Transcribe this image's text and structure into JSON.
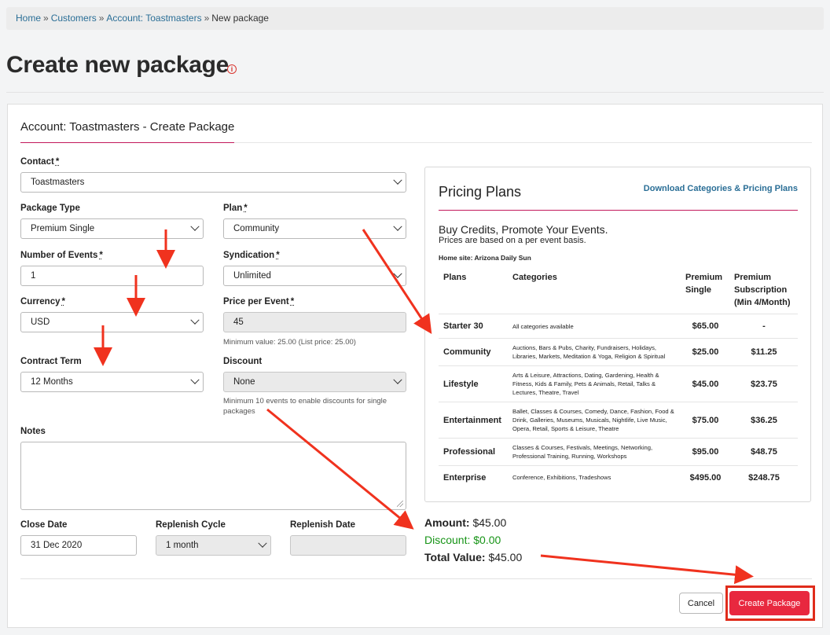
{
  "breadcrumb": {
    "items": [
      {
        "label": "Home"
      },
      {
        "label": "Customers"
      },
      {
        "label": "Account: Toastmasters"
      }
    ],
    "current": "New package",
    "separator": "»"
  },
  "page": {
    "title": "Create new package",
    "info_icon": "info-circle-icon"
  },
  "card": {
    "title": "Account: Toastmasters - Create Package"
  },
  "form": {
    "contact": {
      "label": "Contact",
      "required": "*",
      "value": "Toastmasters"
    },
    "package_type": {
      "label": "Package Type",
      "value": "Premium Single"
    },
    "plan": {
      "label": "Plan",
      "required": "*",
      "value": "Community"
    },
    "number_of_events": {
      "label": "Number of Events",
      "required": "*",
      "value": "1"
    },
    "syndication": {
      "label": "Syndication",
      "required": "*",
      "value": "Unlimited"
    },
    "currency": {
      "label": "Currency",
      "required": "*",
      "value": "USD"
    },
    "price_per_event": {
      "label": "Price per Event",
      "required": "*",
      "value": "45",
      "hint": "Minimum value: 25.00 (List price: 25.00)"
    },
    "contract_term": {
      "label": "Contract Term",
      "value": "12 Months"
    },
    "discount": {
      "label": "Discount",
      "value": "None",
      "hint_line1": "Minimum 10 events to enable discounts for single",
      "hint_line2": "packages"
    },
    "notes": {
      "label": "Notes",
      "value": ""
    },
    "close_date": {
      "label": "Close Date",
      "value": "31 Dec 2020"
    },
    "replenish_cycle": {
      "label": "Replenish Cycle",
      "value": "1 month"
    },
    "replenish_date": {
      "label": "Replenish Date",
      "value": ""
    }
  },
  "pricing": {
    "title": "Pricing Plans",
    "download_link": "Download Categories & Pricing Plans",
    "subtitle": "Buy Credits, Promote Your Events.",
    "note": "Prices are based on a per event basis.",
    "home_site": "Home site: Arizona Daily Sun",
    "columns": {
      "plans": "Plans",
      "categories": "Categories",
      "premium_single_1": "Premium",
      "premium_single_2": "Single",
      "premium_sub_1": "Premium",
      "premium_sub_2": "Subscription",
      "premium_sub_3": "(Min 4/Month)"
    },
    "rows": [
      {
        "plan": "Starter 30",
        "categories": "All categories available",
        "single": "$65.00",
        "subscription": "-"
      },
      {
        "plan": "Community",
        "categories": "Auctions, Bars & Pubs, Charity, Fundraisers, Holidays, Libraries, Markets, Meditation & Yoga, Religion & Spiritual",
        "single": "$25.00",
        "subscription": "$11.25"
      },
      {
        "plan": "Lifestyle",
        "categories": "Arts & Leisure, Attractions, Dating, Gardening, Health & Fitness, Kids & Family, Pets & Animals, Retail, Talks & Lectures, Theatre, Travel",
        "single": "$45.00",
        "subscription": "$23.75"
      },
      {
        "plan": "Entertainment",
        "categories": "Ballet, Classes & Courses, Comedy, Dance, Fashion, Food & Drink, Galleries, Museums, Musicals, Nightlife, Live Music, Opera, Retail, Sports & Leisure, Theatre",
        "single": "$75.00",
        "subscription": "$36.25"
      },
      {
        "plan": "Professional",
        "categories": "Classes & Courses, Festivals, Meetings, Networking, Professional Training, Running, Workshops",
        "single": "$95.00",
        "subscription": "$48.75"
      },
      {
        "plan": "Enterprise",
        "categories": "Conference, Exhibitions, Tradeshows",
        "single": "$495.00",
        "subscription": "$248.75"
      }
    ]
  },
  "totals": {
    "amount_label": "Amount:",
    "amount_value": "$45.00",
    "discount_label": "Discount:",
    "discount_value": "$0.00",
    "total_label": "Total Value:",
    "total_value": "$45.00"
  },
  "buttons": {
    "cancel": "Cancel",
    "create": "Create Package"
  },
  "colors": {
    "link": "#2a6e96",
    "accent_underline": "#c2185b",
    "create_button": "#e8283f",
    "annotation_arrow": "#f0321e",
    "discount_green": "#179417"
  }
}
